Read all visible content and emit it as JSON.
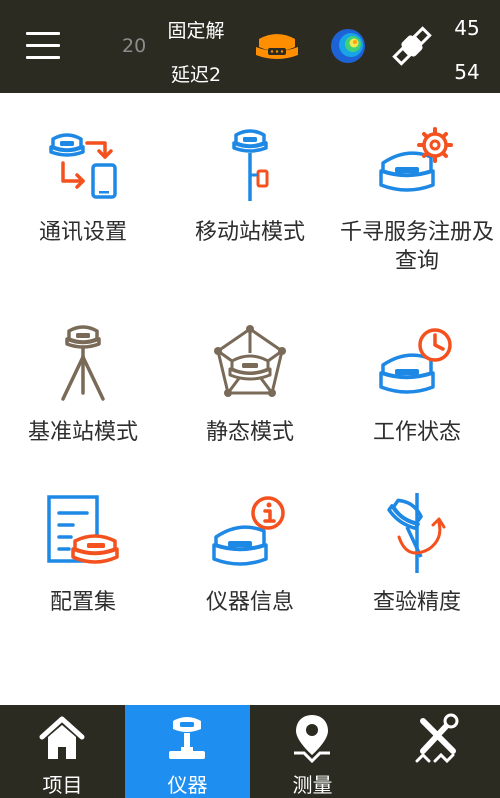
{
  "status_bar": {
    "satellites_used": "20",
    "solution_status": "固定解",
    "delay": "延迟2",
    "count_top": "45",
    "count_bottom": "54",
    "icons": [
      "menu-icon",
      "gnss-receiver-icon",
      "signal-globe-icon",
      "satellite-icon"
    ]
  },
  "grid": {
    "items": [
      {
        "label": "通讯设置",
        "icon": "communication-settings-icon"
      },
      {
        "label": "移动站模式",
        "icon": "rover-mode-icon"
      },
      {
        "label": "千寻服务注册及查询",
        "icon": "service-registration-icon"
      },
      {
        "label": "基准站模式",
        "icon": "base-station-icon"
      },
      {
        "label": "静态模式",
        "icon": "static-mode-icon"
      },
      {
        "label": "工作状态",
        "icon": "work-status-icon"
      },
      {
        "label": "配置集",
        "icon": "configuration-set-icon"
      },
      {
        "label": "仪器信息",
        "icon": "instrument-info-icon"
      },
      {
        "label": "查验精度",
        "icon": "check-accuracy-icon"
      }
    ]
  },
  "bottom_nav": {
    "items": [
      {
        "label": "项目",
        "icon": "home-icon",
        "active": false
      },
      {
        "label": "仪器",
        "icon": "instrument-icon",
        "active": true
      },
      {
        "label": "测量",
        "icon": "location-pin-icon",
        "active": false
      },
      {
        "label": "",
        "icon": "tools-icon",
        "active": false
      }
    ]
  },
  "colors": {
    "bar_background": "#2b2b22",
    "active_tab": "#1e8ff0",
    "icon_blue": "#1e88e5",
    "icon_orange": "#f4511e",
    "icon_brown": "#7a6a58",
    "receiver_orange": "#ff8f00"
  }
}
